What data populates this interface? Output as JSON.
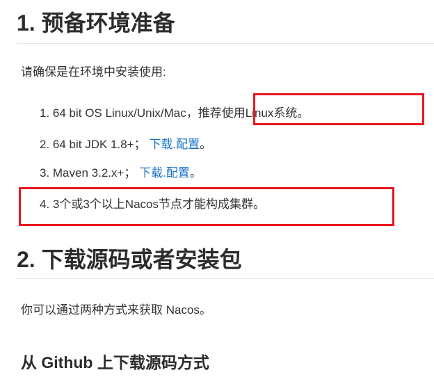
{
  "section1": {
    "heading": "1. 预备环境准备",
    "intro": "请确保是在环境中安装使用:",
    "items": [
      {
        "text_before": "1. 64 bit OS Linux/Unix/Mac，",
        "highlight": "推荐使用Linux系统。"
      },
      {
        "text_before": "2. 64 bit JDK 1.8+； ",
        "link1": "下载",
        "sep": ".",
        "link2": "配置",
        "after": "。"
      },
      {
        "text_before": "3. Maven 3.2.x+； ",
        "link1": "下载",
        "sep": ".",
        "link2": "配置",
        "after": "。"
      },
      {
        "text_before": "4. 3个或3个以上Nacos节点才能构成集群。"
      }
    ]
  },
  "section2": {
    "heading": "2. 下载源码或者安装包",
    "intro": "你可以通过两种方式来获取 Nacos。",
    "subheading": "从 Github 上下载源码方式"
  },
  "colors": {
    "link": "#1a73c9",
    "annotation_box": "#e8161e",
    "heading": "#2c2c2c",
    "body_text": "#333333"
  }
}
